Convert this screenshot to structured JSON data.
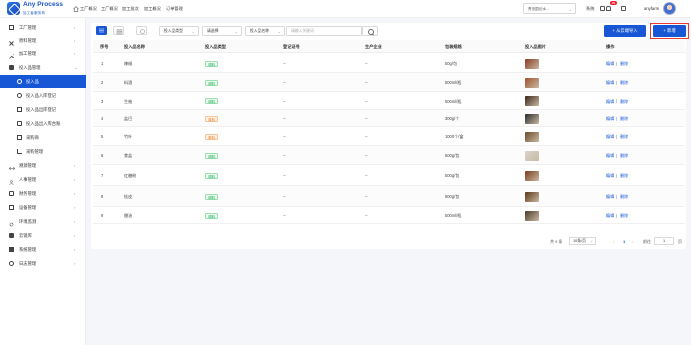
{
  "header": {
    "brand": "Any Process",
    "brand_sub": "加工者服务商",
    "nav": [
      "工厂概况",
      "工厂概况",
      "加工批次",
      "加工概况",
      "订单管理"
    ],
    "site_select": "青岛国记水...",
    "right_link": "系统",
    "notify_count": "99",
    "username": "anyfarm"
  },
  "sidebar": {
    "items": [
      {
        "label": "工厂管理",
        "icon": "factory-icon",
        "arrow": "›"
      },
      {
        "label": "原料管理",
        "icon": "cross-icon",
        "arrow": "›"
      },
      {
        "label": "加工管理",
        "icon": "wrench-icon",
        "arrow": "›"
      },
      {
        "label": "投入品管理",
        "icon": "box-icon",
        "arrow": "⌄"
      },
      {
        "label": "投入品",
        "icon": "circle-icon",
        "active": true
      },
      {
        "label": "投入品入库登记",
        "icon": "cycle-icon"
      },
      {
        "label": "投入品出库登记",
        "icon": "export-icon"
      },
      {
        "label": "投入品出入库台账",
        "icon": "ledger-icon"
      },
      {
        "label": "采购商",
        "icon": "building-icon"
      },
      {
        "label": "采购管理",
        "icon": "cart-icon"
      },
      {
        "label": "溯源管理",
        "icon": "trace-icon",
        "arrow": "›"
      },
      {
        "label": "人事管理",
        "icon": "person-icon",
        "arrow": "›"
      },
      {
        "label": "财务管理",
        "icon": "wallet-icon",
        "arrow": "›"
      },
      {
        "label": "设备管理",
        "icon": "device-icon",
        "arrow": "›"
      },
      {
        "label": "环境监测",
        "icon": "gear-icon",
        "arrow": "›"
      },
      {
        "label": "云镜库",
        "icon": "cloud-icon",
        "arrow": "›"
      },
      {
        "label": "系统管理",
        "icon": "system-icon",
        "arrow": "›"
      },
      {
        "label": "日志管理",
        "icon": "log-icon",
        "arrow": "›"
      }
    ]
  },
  "toolbar": {
    "type_select": "投入品类型",
    "status_select": "请选择",
    "name_select": "投入品名称",
    "search_placeholder": "请输入关键词",
    "import_button": "+ 从云端导入",
    "add_button": "+ 新增"
  },
  "table": {
    "columns": [
      "序号",
      "投入品名称",
      "投入品类型",
      "登记证号",
      "生产企业",
      "包装规格",
      "投入品图片",
      "操作"
    ],
    "rows": [
      {
        "no": "1",
        "name": "辣椒",
        "type": "调料",
        "type_color": "green",
        "reg": "--",
        "maker": "--",
        "spec": "50g/包",
        "img": "#8b3a1f",
        "edit": "编辑",
        "delete": "删除"
      },
      {
        "no": "2",
        "name": "料酒",
        "type": "调料",
        "type_color": "green",
        "reg": "--",
        "maker": "--",
        "spec": "500ml/瓶",
        "img": "#a0522d",
        "edit": "编辑",
        "delete": "删除"
      },
      {
        "no": "3",
        "name": "生抽",
        "type": "调料",
        "type_color": "green",
        "reg": "--",
        "maker": "--",
        "spec": "500ml/瓶",
        "img": "#3b2417",
        "edit": "编辑",
        "delete": "删除"
      },
      {
        "no": "4",
        "name": "盐巴",
        "type": "原料",
        "type_color": "orange",
        "reg": "--",
        "maker": "--",
        "spec": "300g/个",
        "img": "#2a2a2a",
        "edit": "编辑",
        "delete": "删除"
      },
      {
        "no": "5",
        "name": "竹叶",
        "type": "原料",
        "type_color": "orange",
        "reg": "--",
        "maker": "--",
        "spec": "1000个/盒",
        "img": "#6b4a2a",
        "edit": "编辑",
        "delete": "删除"
      },
      {
        "no": "6",
        "name": "食盐",
        "type": "调料",
        "type_color": "green",
        "reg": "--",
        "maker": "--",
        "spec": "500g/包",
        "img": "#d9d4cc",
        "edit": "编辑",
        "delete": "删除"
      },
      {
        "no": "7",
        "name": "红糖粉",
        "type": "调料",
        "type_color": "green",
        "reg": "--",
        "maker": "--",
        "spec": "500g/包",
        "img": "#7a3b1c",
        "edit": "编辑",
        "delete": "删除"
      },
      {
        "no": "8",
        "name": "桂皮",
        "type": "调料",
        "type_color": "green",
        "reg": "--",
        "maker": "--",
        "spec": "500g/包",
        "img": "#5a3516",
        "edit": "编辑",
        "delete": "删除"
      },
      {
        "no": "9",
        "name": "醋油",
        "type": "调料",
        "type_color": "green",
        "reg": "--",
        "maker": "--",
        "spec": "500ml/瓶",
        "img": "#4a3a2a",
        "edit": "编辑",
        "delete": "删除"
      }
    ]
  },
  "pagination": {
    "total": "共 9 条",
    "page_size": "10条/页",
    "prev": "‹",
    "current": "1",
    "next": "›",
    "goto_label": "前往",
    "goto_value": "1",
    "page_unit": "页"
  },
  "colors": {
    "accent": "#1757d6",
    "tag_green": "#27ae60",
    "tag_orange": "#e67e22"
  }
}
